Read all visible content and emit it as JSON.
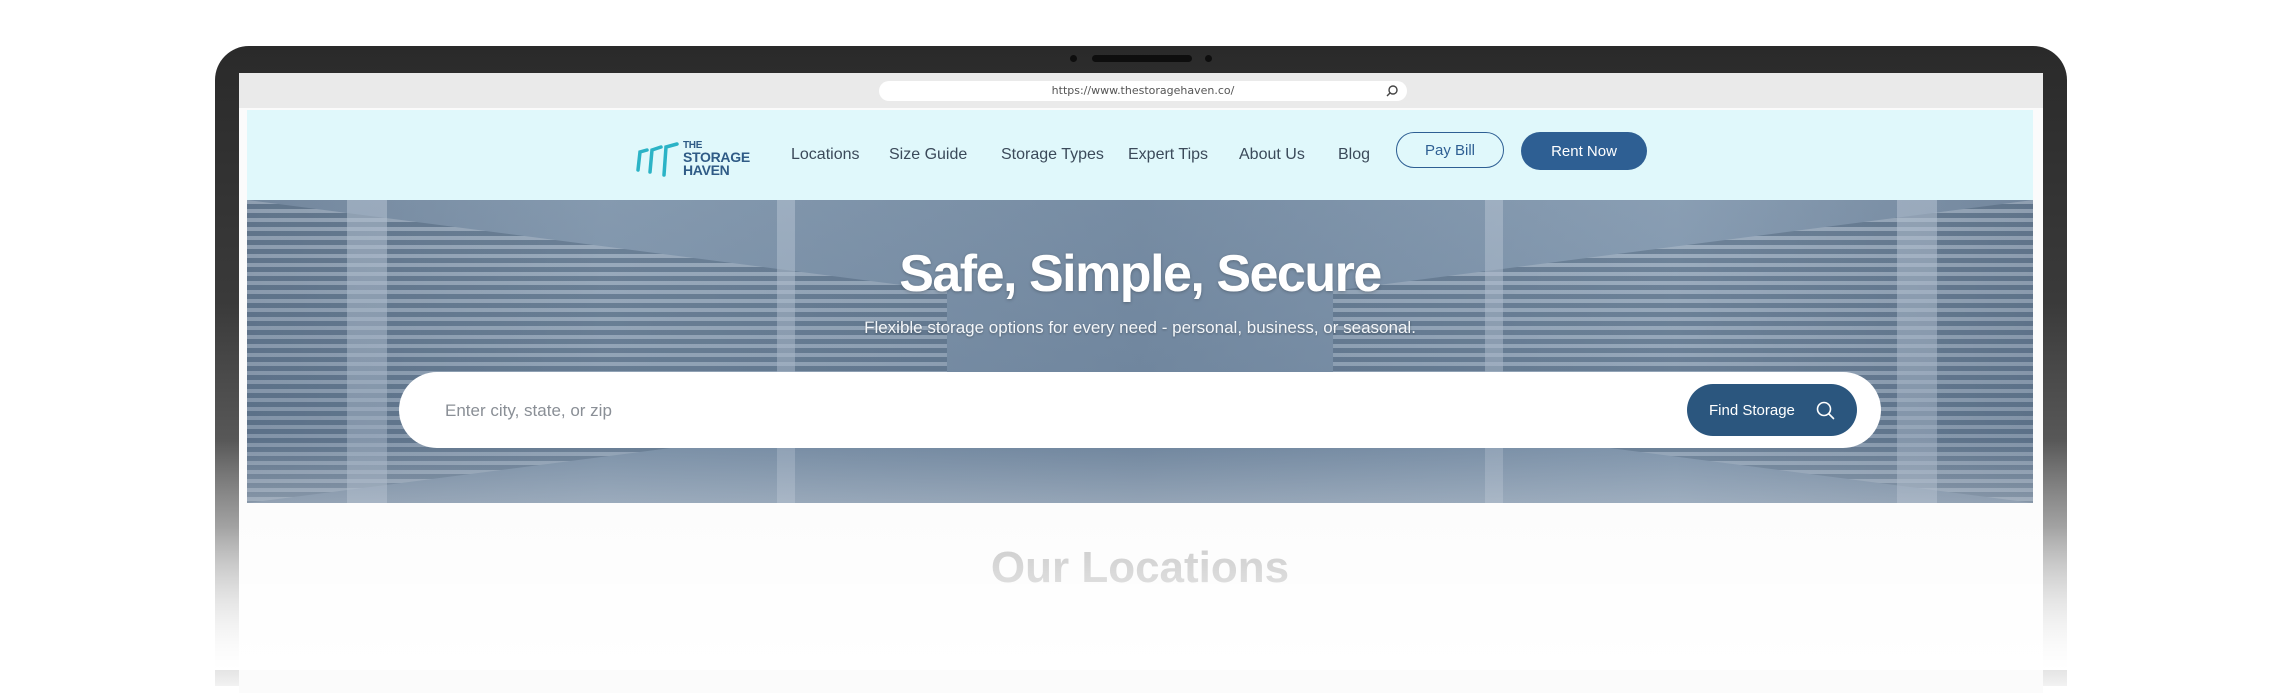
{
  "browser": {
    "url": "https://www.thestoragehaven.co/"
  },
  "brand": {
    "line1": "THE",
    "line2": "STORAGE",
    "line3": "HAVEN"
  },
  "nav": {
    "items": [
      {
        "label": "Locations"
      },
      {
        "label": "Size Guide"
      },
      {
        "label": "Storage Types"
      },
      {
        "label": "Expert Tips"
      },
      {
        "label": "About Us"
      },
      {
        "label": "Blog"
      }
    ],
    "pay_bill": "Pay Bill",
    "rent_now": "Rent Now"
  },
  "hero": {
    "title": "Safe, Simple, Secure",
    "subtitle": "Flexible storage options for every need - personal, business, or seasonal.",
    "search_placeholder": "Enter city, state, or zip",
    "find_button": "Find Storage"
  },
  "locations": {
    "title": "Our Locations"
  },
  "colors": {
    "nav_bg": "#e0f8fb",
    "primary": "#2e5f93",
    "find_button": "#2b567e",
    "brand_teal": "#2bb3c6"
  }
}
